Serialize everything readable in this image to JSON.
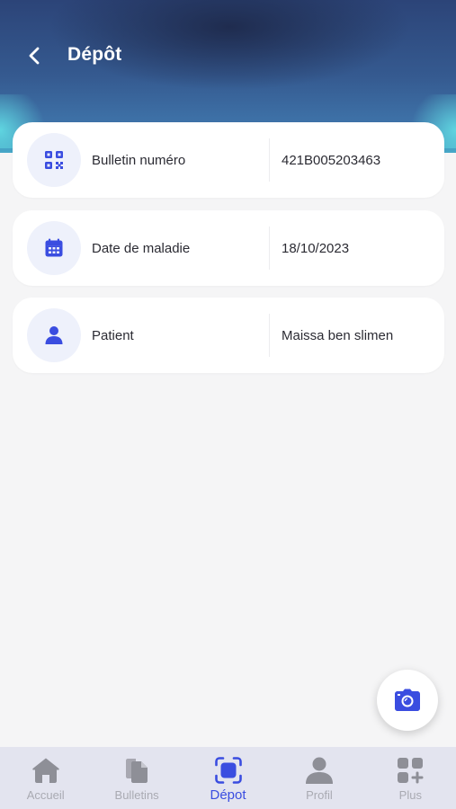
{
  "header": {
    "title": "Dépôt",
    "back_icon": "chevron-left-icon"
  },
  "fields": [
    {
      "icon": "qr-code-icon",
      "label": "Bulletin numéro",
      "value": "421B005203463"
    },
    {
      "icon": "calendar-icon",
      "label": "Date de maladie",
      "value": "18/10/2023"
    },
    {
      "icon": "user-icon",
      "label": "Patient",
      "value": "Maissa ben slimen"
    }
  ],
  "fab": {
    "icon": "camera-icon"
  },
  "nav": {
    "items": [
      {
        "label": "Accueil",
        "icon": "home-icon",
        "active": false
      },
      {
        "label": "Bulletins",
        "icon": "documents-icon",
        "active": false
      },
      {
        "label": "Dépot",
        "icon": "scan-icon",
        "active": true
      },
      {
        "label": "Profil",
        "icon": "profile-icon",
        "active": false
      },
      {
        "label": "Plus",
        "icon": "grid-plus-icon",
        "active": false
      }
    ]
  },
  "colors": {
    "accent": "#3a4de0",
    "header_dark": "#2c4478",
    "header_cyan": "#47a8c8",
    "card_bg": "#ffffff",
    "icon_bg": "#eef1fb",
    "nav_bg": "#e3e4ef",
    "nav_inactive": "#a9aab2",
    "page_bg": "#f5f5f6"
  }
}
